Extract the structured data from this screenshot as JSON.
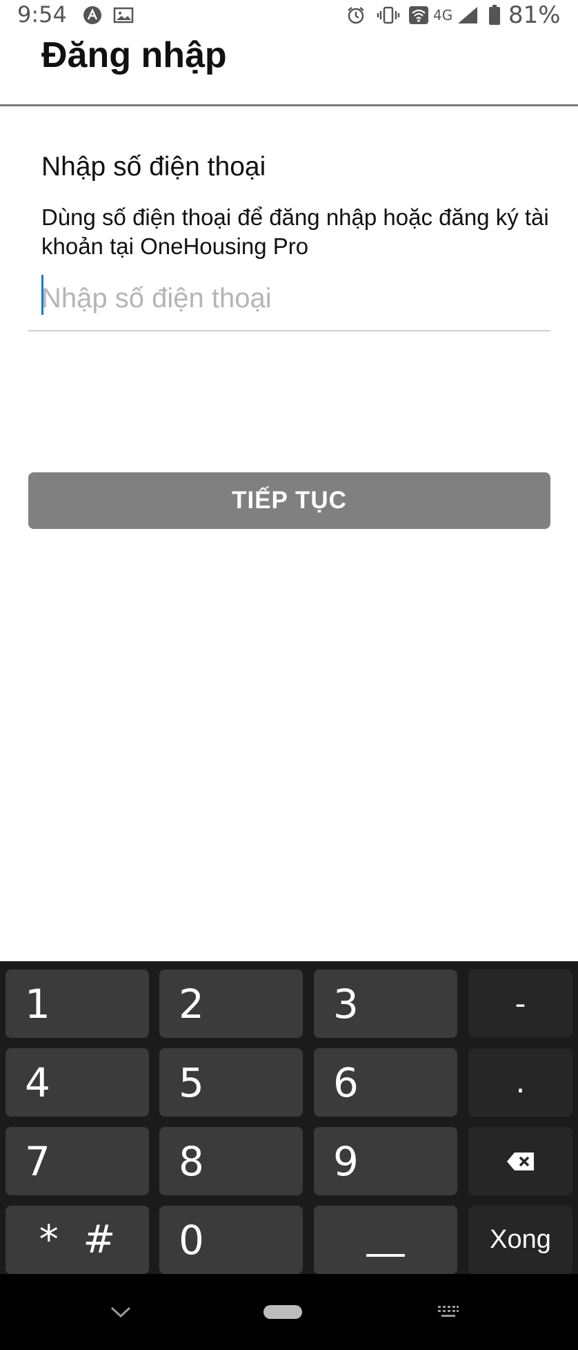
{
  "status_bar": {
    "time": "9:54",
    "network": "4G",
    "battery": "81%",
    "icons": [
      "app-notification-icon",
      "image-notification-icon",
      "alarm-icon",
      "vibrate-icon",
      "wifi-icon",
      "signal-icon",
      "battery-icon"
    ]
  },
  "header": {
    "title": "Đăng nhập"
  },
  "form": {
    "title": "Nhập số điện thoại",
    "description": "Dùng số điện thoại để đăng nhập hoặc đăng ký tài khoản tại OneHousing Pro",
    "phone_value": "",
    "phone_placeholder": "Nhập số điện thoại",
    "continue_label": "TIẾP TỤC"
  },
  "keyboard": {
    "keys": [
      "1",
      "2",
      "3",
      "-",
      "4",
      "5",
      "6",
      ".",
      "7",
      "8",
      "9",
      "*  #",
      "0"
    ],
    "backspace_icon": "backspace-icon",
    "space_icon": "space-icon",
    "done_label": "Xong"
  },
  "nav_bar": {
    "icons": [
      "hide-keyboard-icon",
      "home-pill-icon",
      "keyboard-switch-icon"
    ]
  },
  "colors": {
    "button": "#808080",
    "caret": "#1976d2",
    "keyboard_bg": "#1b1b1b",
    "key": "#3b3b3b",
    "fn_key": "#262626"
  }
}
